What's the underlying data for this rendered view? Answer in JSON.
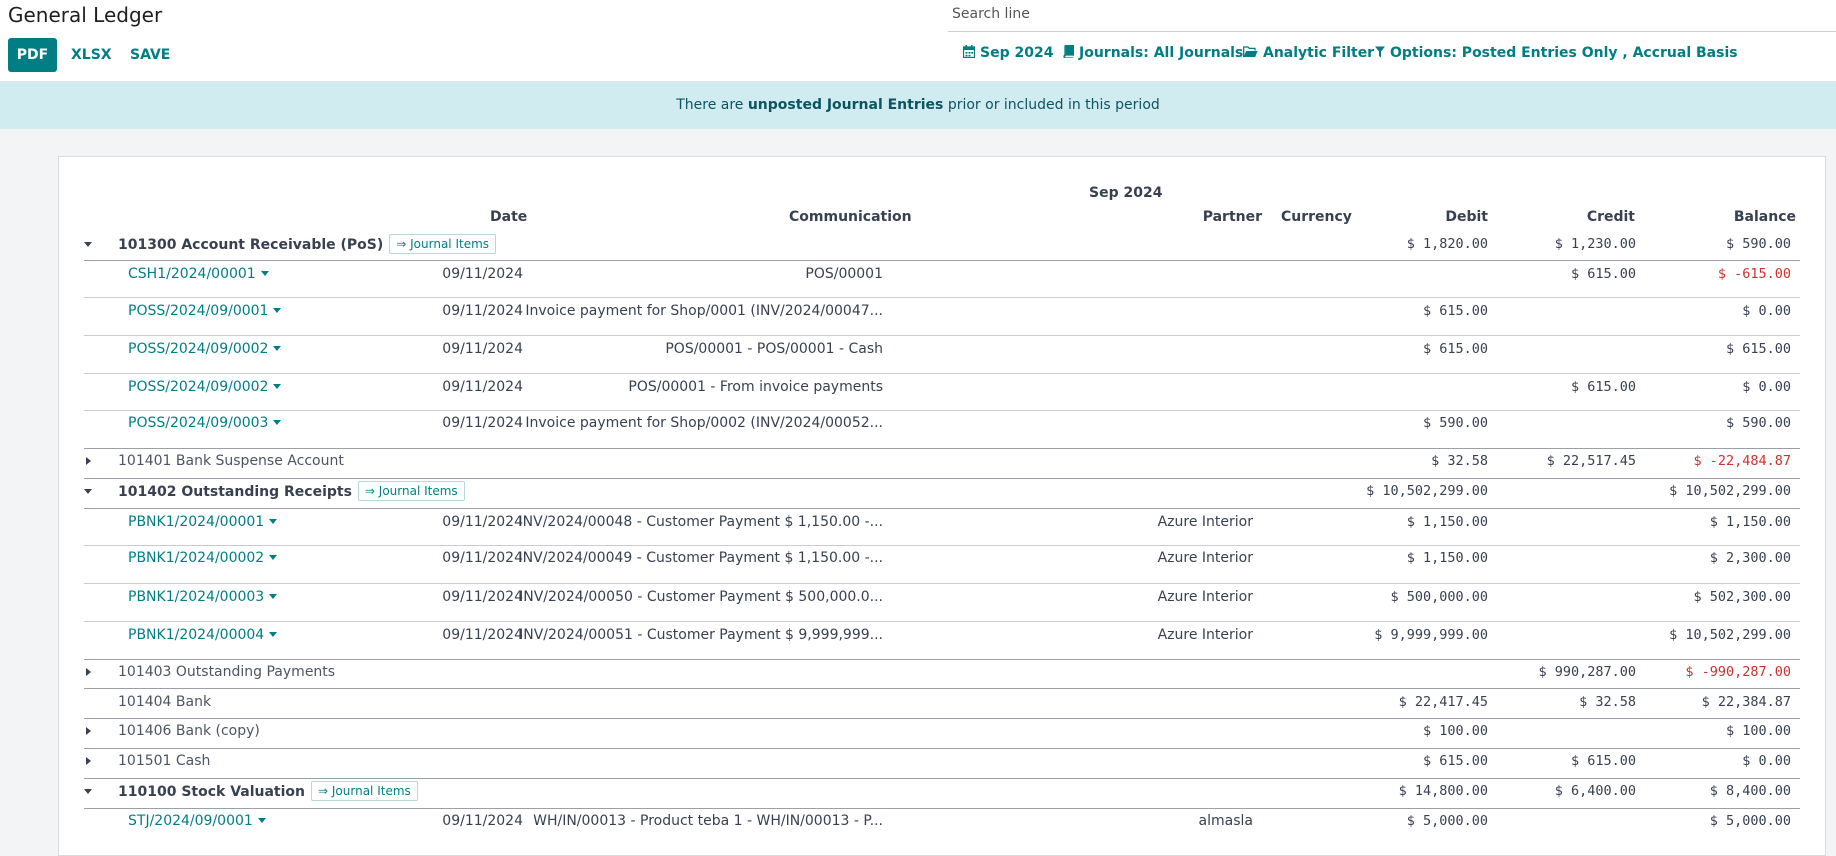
{
  "page": {
    "title": "General Ledger"
  },
  "toolbar": {
    "pdf": "PDF",
    "xlsx": "XLSX",
    "save": "SAVE"
  },
  "search": {
    "placeholder": "Search line"
  },
  "filters": {
    "date": "Sep 2024",
    "journals": "Journals: All Journals",
    "analytic": "Analytic Filter",
    "options": "Options: Posted Entries Only , Accrual Basis"
  },
  "banner": {
    "pre": "There are ",
    "link": "unposted Journal Entries",
    "post": " prior or included in this period"
  },
  "report": {
    "period": "Sep 2024",
    "headers": {
      "date": "Date",
      "communication": "Communication",
      "partner": "Partner",
      "currency": "Currency",
      "debit": "Debit",
      "credit": "Credit",
      "balance": "Balance"
    },
    "journal_items_label": "⇒ Journal Items",
    "rows": [
      {
        "kind": "account",
        "expanded": true,
        "label": "101300 Account Receivable (PoS)",
        "journal_items": true,
        "debit": "$ 1,820.00",
        "credit": "$ 1,230.00",
        "balance": "$ 590.00"
      },
      {
        "kind": "line",
        "ref": "CSH1/2024/00001",
        "date": "09/11/2024",
        "comm": "POS/00001",
        "partner": "",
        "debit": "",
        "credit": "$ 615.00",
        "balance": "$ -615.00",
        "neg": true
      },
      {
        "kind": "line",
        "ref": "POSS/2024/09/0001",
        "date": "09/11/2024",
        "comm": "Invoice payment for Shop/0001 (INV/2024/00047...",
        "partner": "",
        "debit": "$ 615.00",
        "credit": "",
        "balance": "$ 0.00"
      },
      {
        "kind": "line",
        "ref": "POSS/2024/09/0002",
        "date": "09/11/2024",
        "comm": "POS/00001 - POS/00001 - Cash",
        "partner": "",
        "debit": "$ 615.00",
        "credit": "",
        "balance": "$ 615.00"
      },
      {
        "kind": "line",
        "ref": "POSS/2024/09/0002",
        "date": "09/11/2024",
        "comm": "POS/00001 - From invoice payments",
        "partner": "",
        "debit": "",
        "credit": "$ 615.00",
        "balance": "$ 0.00"
      },
      {
        "kind": "line",
        "ref": "POSS/2024/09/0003",
        "date": "09/11/2024",
        "comm": "Invoice payment for Shop/0002 (INV/2024/00052...",
        "partner": "",
        "debit": "$ 590.00",
        "credit": "",
        "balance": "$ 590.00"
      },
      {
        "kind": "account",
        "expanded": false,
        "label": "101401 Bank Suspense Account",
        "journal_items": false,
        "debit": "$ 32.58",
        "credit": "$ 22,517.45",
        "balance": "$ -22,484.87",
        "neg": true
      },
      {
        "kind": "account",
        "expanded": true,
        "label": "101402 Outstanding Receipts",
        "journal_items": true,
        "debit": "$ 10,502,299.00",
        "credit": "",
        "balance": "$ 10,502,299.00"
      },
      {
        "kind": "line",
        "ref": "PBNK1/2024/00001",
        "date": "09/11/2024",
        "comm": "INV/2024/00048 - Customer Payment $ 1,150.00 -...",
        "partner": "Azure Interior",
        "debit": "$ 1,150.00",
        "credit": "",
        "balance": "$ 1,150.00"
      },
      {
        "kind": "line",
        "ref": "PBNK1/2024/00002",
        "date": "09/11/2024",
        "comm": "INV/2024/00049 - Customer Payment $ 1,150.00 -...",
        "partner": "Azure Interior",
        "debit": "$ 1,150.00",
        "credit": "",
        "balance": "$ 2,300.00"
      },
      {
        "kind": "line",
        "ref": "PBNK1/2024/00003",
        "date": "09/11/2024",
        "comm": "INV/2024/00050 - Customer Payment $ 500,000.0...",
        "partner": "Azure Interior",
        "debit": "$ 500,000.00",
        "credit": "",
        "balance": "$ 502,300.00"
      },
      {
        "kind": "line",
        "ref": "PBNK1/2024/00004",
        "date": "09/11/2024",
        "comm": "INV/2024/00051 - Customer Payment $ 9,999,999...",
        "partner": "Azure Interior",
        "debit": "$ 9,999,999.00",
        "credit": "",
        "balance": "$ 10,502,299.00"
      },
      {
        "kind": "account",
        "expanded": false,
        "label": "101403 Outstanding Payments",
        "journal_items": false,
        "debit": "",
        "credit": "$ 990,287.00",
        "balance": "$ -990,287.00",
        "neg": true
      },
      {
        "kind": "account",
        "expanded": null,
        "label": "101404 Bank",
        "journal_items": false,
        "debit": "$ 22,417.45",
        "credit": "$ 32.58",
        "balance": "$ 22,384.87"
      },
      {
        "kind": "account",
        "expanded": false,
        "label": "101406 Bank (copy)",
        "journal_items": false,
        "debit": "$ 100.00",
        "credit": "",
        "balance": "$ 100.00"
      },
      {
        "kind": "account",
        "expanded": false,
        "label": "101501 Cash",
        "journal_items": false,
        "debit": "$ 615.00",
        "credit": "$ 615.00",
        "balance": "$ 0.00"
      },
      {
        "kind": "account",
        "expanded": true,
        "label": "110100 Stock Valuation",
        "journal_items": true,
        "debit": "$ 14,800.00",
        "credit": "$ 6,400.00",
        "balance": "$ 8,400.00"
      },
      {
        "kind": "line",
        "ref": "STJ/2024/09/0001",
        "date": "09/11/2024",
        "comm": "WH/IN/00013 - Product teba 1 - WH/IN/00013 - P...",
        "partner": "almasla",
        "debit": "$ 5,000.00",
        "credit": "",
        "balance": "$ 5,000.00"
      }
    ]
  }
}
